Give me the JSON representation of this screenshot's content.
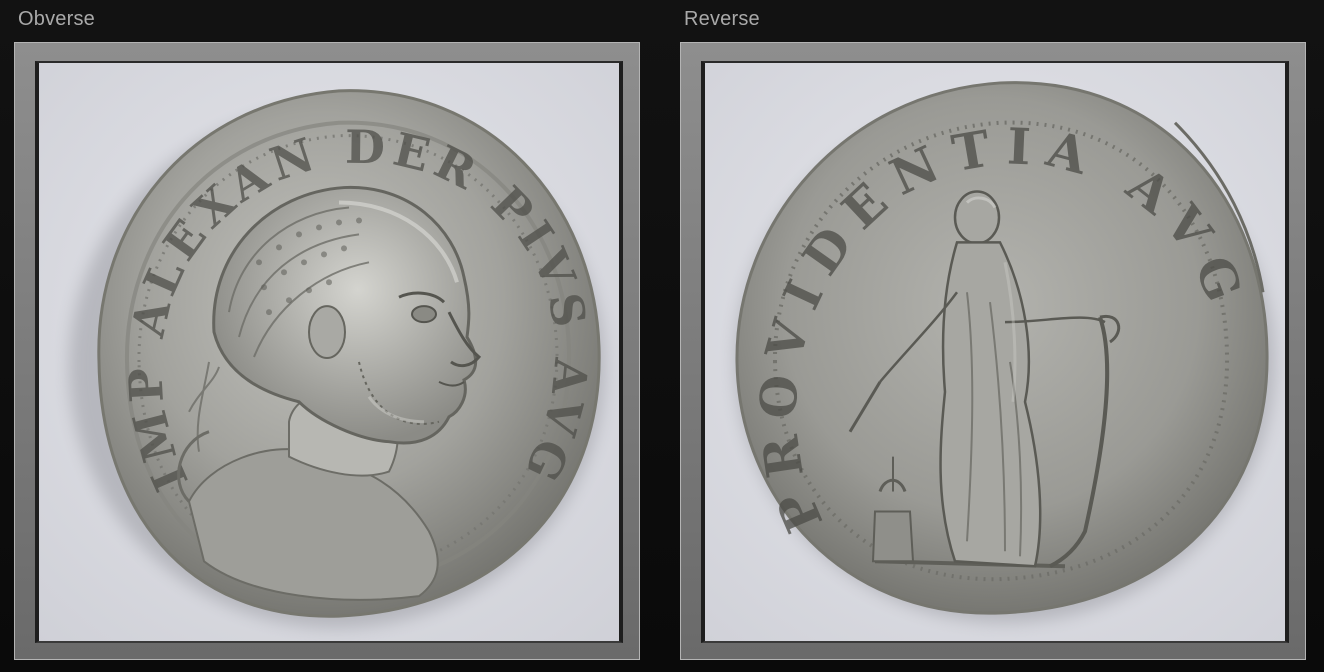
{
  "panels": {
    "obverse": {
      "title": "Obverse",
      "legend": "IMP ALEXAN DER PIVS AVG"
    },
    "reverse": {
      "title": "Reverse",
      "legend": "PROVIDENTIA AVG"
    }
  },
  "colors": {
    "background": "#0d0d0d",
    "frame": "#7c7c7c",
    "backdrop": "#dcdde3",
    "silver": "#a6a6a2",
    "title_text": "#a9a9a9"
  }
}
